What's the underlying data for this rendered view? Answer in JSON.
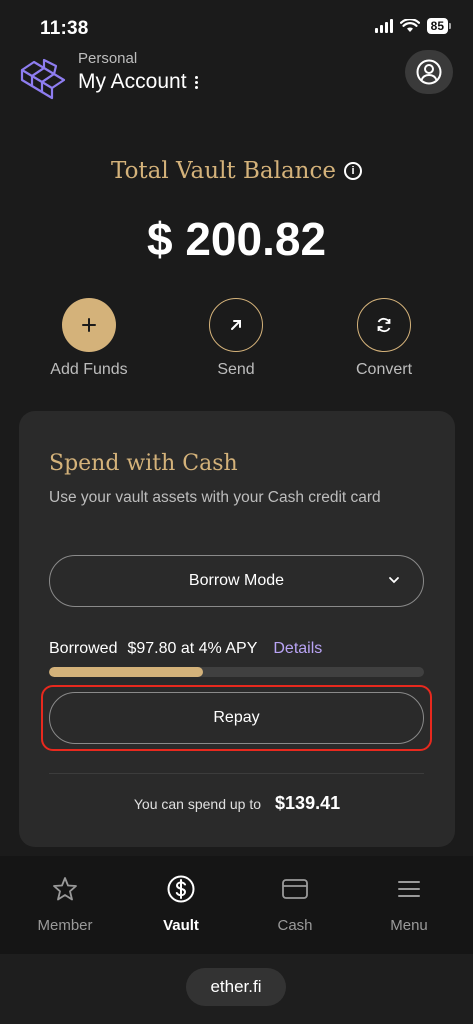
{
  "status_bar": {
    "time": "11:38",
    "battery": "85"
  },
  "account": {
    "subtitle": "Personal",
    "name": "My Account"
  },
  "balance": {
    "label": "Total Vault Balance",
    "value": "$ 200.82"
  },
  "actions": [
    {
      "label": "Add Funds",
      "icon": "plus-icon"
    },
    {
      "label": "Send",
      "icon": "arrow-up-right-icon"
    },
    {
      "label": "Convert",
      "icon": "refresh-icon"
    }
  ],
  "spend_card": {
    "title": "Spend with Cash",
    "description": "Use your vault assets with your Cash credit card",
    "mode_select": "Borrow Mode",
    "borrowed_label": "Borrowed",
    "borrowed_value": "$97.80 at 4% APY",
    "details_link": "Details",
    "borrowed_fraction": 0.41,
    "repay_button": "Repay",
    "spend_label": "You can spend up to",
    "spend_value": "$139.41"
  },
  "tabs": [
    {
      "label": "Member",
      "icon": "star-icon",
      "active": false
    },
    {
      "label": "Vault",
      "icon": "dollar-circle-icon",
      "active": true
    },
    {
      "label": "Cash",
      "icon": "card-icon",
      "active": false
    },
    {
      "label": "Menu",
      "icon": "menu-icon",
      "active": false
    }
  ],
  "browser": {
    "url": "ether.fi"
  },
  "colors": {
    "accent": "#d4b27a",
    "link": "#b9a4f5",
    "highlight": "#e8291e",
    "background": "#1b1b1b"
  }
}
